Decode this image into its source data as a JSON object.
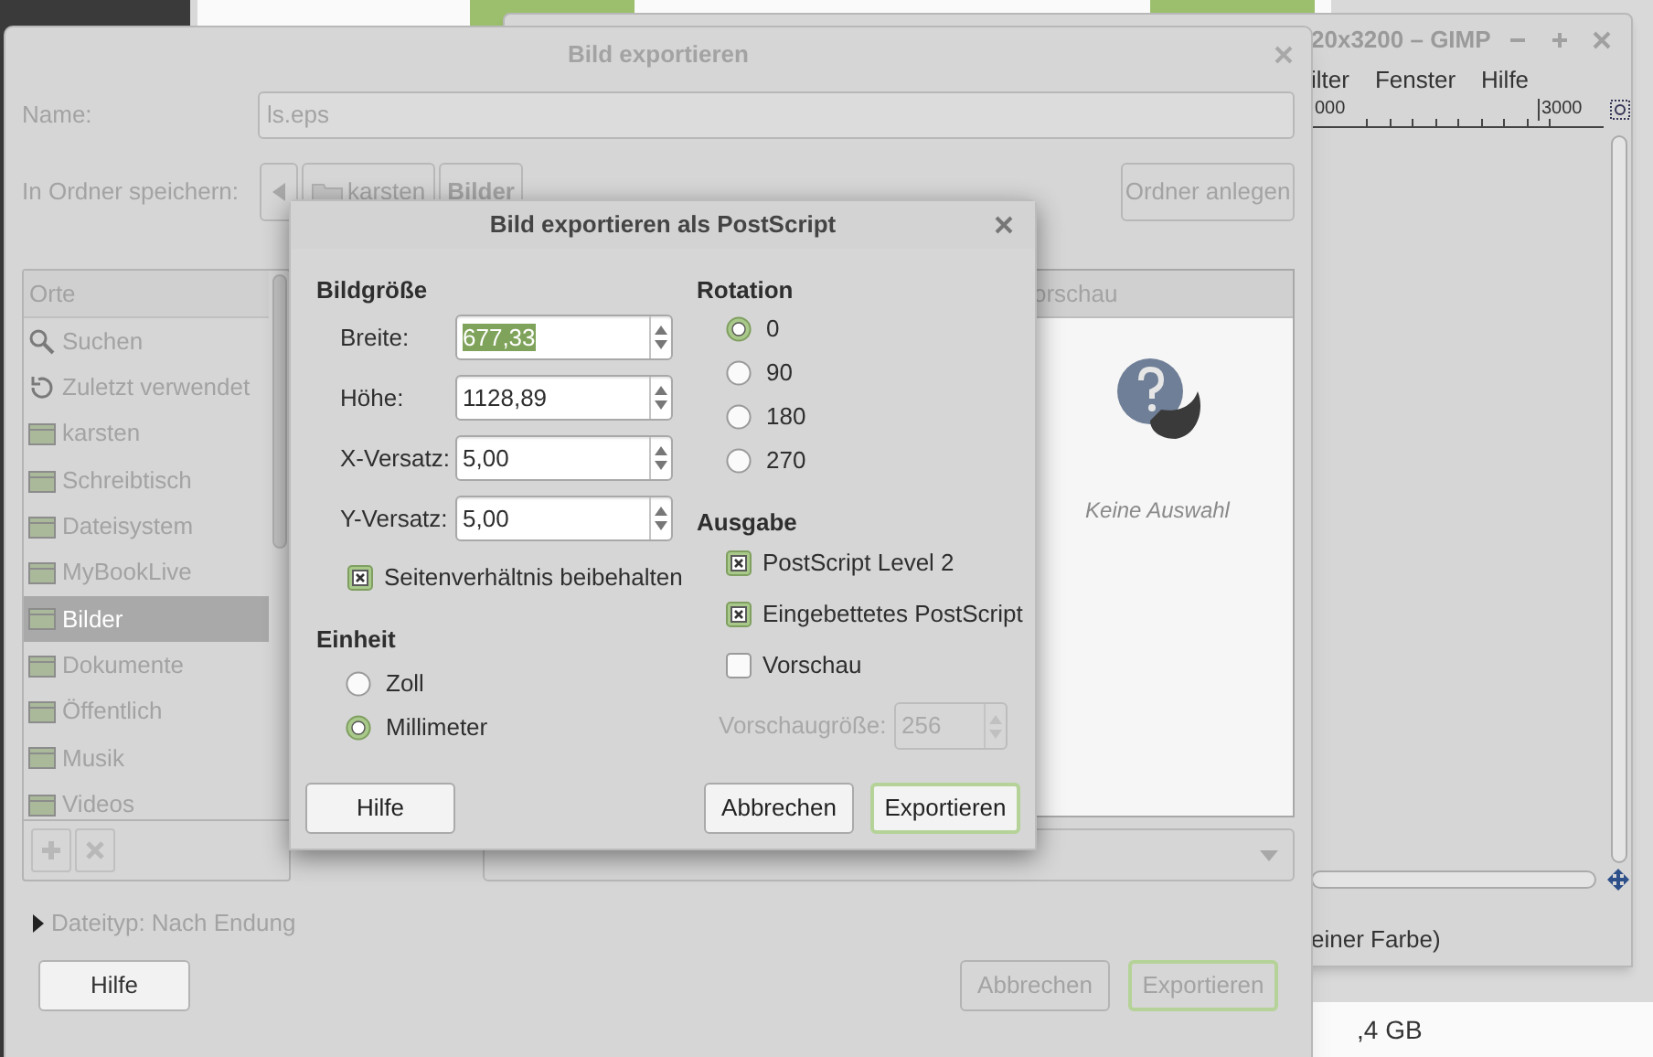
{
  "gimp_window": {
    "title": "20x3200 – GIMP",
    "menu": [
      "ilter",
      "Fenster",
      "Hilfe"
    ],
    "ruler_labels": [
      "000",
      "3000"
    ],
    "status_text": "einer Farbe)"
  },
  "panel": {
    "text": ",4 GB"
  },
  "export_dialog": {
    "title": "Bild exportieren",
    "name_label": "Name:",
    "name_value": "ls.eps",
    "folder_label": "In Ordner speichern:",
    "path_buttons": [
      {
        "label": "karsten",
        "kind": "home",
        "selected": false
      },
      {
        "label": "Bilder",
        "kind": "plain",
        "selected": true
      }
    ],
    "create_folder_button": "Ordner anlegen",
    "places_header": "Orte",
    "places": [
      {
        "label": "Suchen",
        "kind": "search",
        "selected": false
      },
      {
        "label": "Zuletzt verwendet",
        "kind": "recent",
        "selected": false
      },
      {
        "label": "karsten",
        "kind": "folder",
        "selected": false
      },
      {
        "label": "Schreibtisch",
        "kind": "folder",
        "selected": false
      },
      {
        "label": "Dateisystem",
        "kind": "folder",
        "selected": false
      },
      {
        "label": "MyBookLive",
        "kind": "folder",
        "selected": false
      },
      {
        "label": "Bilder",
        "kind": "folder",
        "selected": true
      },
      {
        "label": "Dokumente",
        "kind": "folder",
        "selected": false
      },
      {
        "label": "Öffentlich",
        "kind": "folder",
        "selected": false
      },
      {
        "label": "Musik",
        "kind": "folder",
        "selected": false
      },
      {
        "label": "Videos",
        "kind": "folder",
        "selected": false
      }
    ],
    "preview_header": "orschau",
    "preview_text": "Keine Auswahl",
    "filetype_expander": {
      "label": "Dateityp: Nach Endung",
      "expanded": false
    },
    "buttons": [
      {
        "label": "Hilfe",
        "default": false
      },
      {
        "label": "Abbrechen",
        "default": false
      },
      {
        "label": "Exportieren",
        "default": true
      }
    ]
  },
  "ps_dialog": {
    "title": "Bild exportieren als PostScript",
    "size_heading": "Bildgröße",
    "fields": [
      {
        "label": "Breite:",
        "value": "677,33",
        "text_selected": true
      },
      {
        "label": "Höhe:",
        "value": "1128,89",
        "text_selected": false
      },
      {
        "label": "X-Versatz:",
        "value": "5,00",
        "text_selected": false
      },
      {
        "label": "Y-Versatz:",
        "value": "5,00",
        "text_selected": false
      }
    ],
    "keep_ratio": {
      "label": "Seitenverhältnis beibehalten",
      "checked": true
    },
    "unit_heading": "Einheit",
    "units": [
      {
        "label": "Zoll",
        "selected": false
      },
      {
        "label": "Millimeter",
        "selected": true
      }
    ],
    "rotation_heading": "Rotation",
    "rotations": [
      {
        "label": "0",
        "selected": true
      },
      {
        "label": "90",
        "selected": false
      },
      {
        "label": "180",
        "selected": false
      },
      {
        "label": "270",
        "selected": false
      }
    ],
    "output_heading": "Ausgabe",
    "outputs": [
      {
        "label": "PostScript Level 2",
        "checked": true
      },
      {
        "label": "Eingebettetes PostScript",
        "checked": true
      },
      {
        "label": "Vorschau",
        "checked": false
      }
    ],
    "preview_size": {
      "label": "Vorschaugröße:",
      "value": "256",
      "disabled": true
    },
    "buttons": [
      {
        "label": "Hilfe",
        "default": false
      },
      {
        "label": "Abbrechen",
        "default": false
      },
      {
        "label": "Exportieren",
        "default": true
      }
    ]
  }
}
